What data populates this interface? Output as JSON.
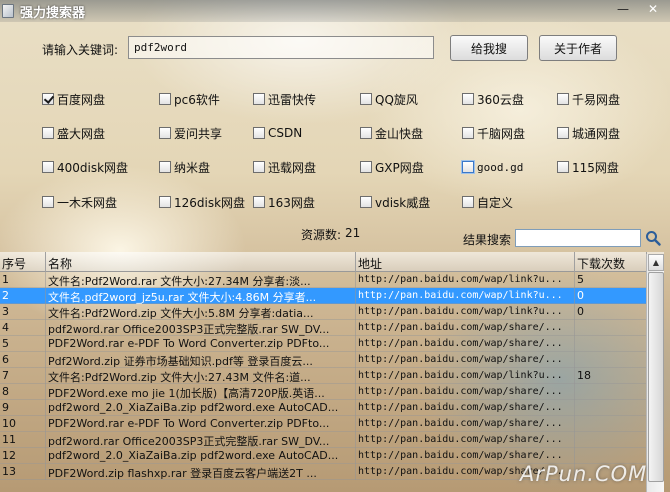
{
  "window": {
    "title": "强力搜索器",
    "min_label": "—",
    "close_label": "✕"
  },
  "search": {
    "label": "请输入关键词:",
    "value": "pdf2word",
    "submit_label": "给我搜",
    "about_label": "关于作者"
  },
  "sites": [
    {
      "label": "百度网盘",
      "checked": true,
      "mono": false
    },
    {
      "label": "pc6软件",
      "checked": false,
      "mono": false
    },
    {
      "label": "迅雷快传",
      "checked": false,
      "mono": false
    },
    {
      "label": "QQ旋风",
      "checked": false,
      "mono": false
    },
    {
      "label": "360云盘",
      "checked": false,
      "mono": false
    },
    {
      "label": "千易网盘",
      "checked": false,
      "mono": false
    },
    {
      "label": "盛大网盘",
      "checked": false,
      "mono": false
    },
    {
      "label": "爱问共享",
      "checked": false,
      "mono": false
    },
    {
      "label": "CSDN",
      "checked": false,
      "mono": false
    },
    {
      "label": "金山快盘",
      "checked": false,
      "mono": false
    },
    {
      "label": "千脑网盘",
      "checked": false,
      "mono": false
    },
    {
      "label": "城通网盘",
      "checked": false,
      "mono": false
    },
    {
      "label": "400disk网盘",
      "checked": false,
      "mono": false
    },
    {
      "label": "纳米盘",
      "checked": false,
      "mono": false
    },
    {
      "label": "迅载网盘",
      "checked": false,
      "mono": false
    },
    {
      "label": "GXP网盘",
      "checked": false,
      "mono": false
    },
    {
      "label": "good.gd",
      "checked": false,
      "mono": true
    },
    {
      "label": "115网盘",
      "checked": false,
      "mono": false
    },
    {
      "label": "一木禾网盘",
      "checked": false,
      "mono": false
    },
    {
      "label": "126disk网盘",
      "checked": false,
      "mono": false
    },
    {
      "label": "163网盘",
      "checked": false,
      "mono": false
    },
    {
      "label": "vdisk威盘",
      "checked": false,
      "mono": false
    },
    {
      "label": "自定义",
      "checked": false,
      "mono": false
    }
  ],
  "resource_count": {
    "label": "资源数:",
    "value": "21"
  },
  "result_search": {
    "label": "结果搜索",
    "value": ""
  },
  "table": {
    "columns": [
      "序号",
      "名称",
      "地址",
      "下载次数"
    ],
    "selected_index": 1,
    "rows": [
      [
        "1",
        "文件名:Pdf2Word.rar 文件大小:27.34M 分享者:淡...",
        "http://pan.baidu.com/wap/link?u...",
        "5"
      ],
      [
        "2",
        "文件名.pdf2word_jz5u.rar 文件大小:4.86M 分享者...",
        "http://pan.baidu.com/wap/link?u...",
        "0"
      ],
      [
        "3",
        "文件名:Pdf2Word.zip 文件大小:5.8M 分享者:datia...",
        "http://pan.baidu.com/wap/link?u...",
        "0"
      ],
      [
        "4",
        "pdf2word.rar Office2003SP3正式完整版.rar SW_DV...",
        "http://pan.baidu.com/wap/share/...",
        ""
      ],
      [
        "5",
        "PDF2Word.rar e-PDF To Word Converter.zip PDFto...",
        "http://pan.baidu.com/wap/share/...",
        ""
      ],
      [
        "6",
        "Pdf2Word.zip 证券市场基础知识.pdf等 登录百度云...",
        "http://pan.baidu.com/wap/share/...",
        ""
      ],
      [
        "7",
        "文件名:Pdf2Word.zip 文件大小:27.43M 文件名:道...",
        "http://pan.baidu.com/wap/link?u...",
        "18"
      ],
      [
        "8",
        "PDF2Word.exe mo jie 1(加长版)【高清720P版.英语...",
        "http://pan.baidu.com/wap/share/...",
        ""
      ],
      [
        "9",
        "pdf2word_2.0_XiaZaiBa.zip pdf2word.exe AutoCAD...",
        "http://pan.baidu.com/wap/share/...",
        ""
      ],
      [
        "10",
        "PDF2Word.rar e-PDF To Word Converter.zip PDFto...",
        "http://pan.baidu.com/wap/share/...",
        ""
      ],
      [
        "11",
        "pdf2word.rar Office2003SP3正式完整版.rar SW_DV...",
        "http://pan.baidu.com/wap/share/...",
        ""
      ],
      [
        "12",
        "pdf2word_2.0_XiaZaiBa.zip pdf2word.exe AutoCAD...",
        "http://pan.baidu.com/wap/share/...",
        ""
      ],
      [
        "13",
        "PDF2Word.zip flashxp.rar 登录百度云客户端送2T ...",
        "http://pan.baidu.com/wap/share/...",
        ""
      ]
    ]
  },
  "watermark": "ArPun.COM",
  "colors": {
    "selected_row": "#3399ff",
    "titlebar_text": "#ffffff"
  }
}
